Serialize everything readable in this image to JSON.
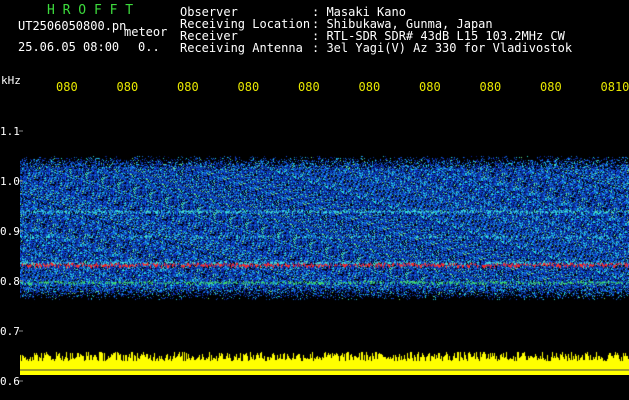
{
  "header": {
    "title": "H R O F F T",
    "filename": "UT2506050800.pn",
    "type_label": "meteor",
    "datetime": "25.06.05 08:00",
    "counter": "0..",
    "fields": [
      {
        "label": "Observer",
        "value": ": Masaki Kano"
      },
      {
        "label": "Receiving Location",
        "value": ": Shibukawa, Gunma, Japan"
      },
      {
        "label": "Receiver",
        "value": ": RTL-SDR SDR# 43dB L15 103.2MHz CW"
      },
      {
        "label": "Receiving Antenna",
        "value": ": 3el Yagi(V) Az 330 for Vladivostok"
      }
    ]
  },
  "axes": {
    "y_unit": "kHz",
    "y_ticks": [
      "1.1",
      "1.0",
      "0.9",
      "0.8",
      "0.7",
      "0.6"
    ],
    "x_ticks": [
      "080",
      "080",
      "080",
      "080",
      "080",
      "080",
      "080",
      "080",
      "080",
      "0810"
    ]
  },
  "colors": {
    "background": "#000000",
    "noise_low": "#0b1a8f",
    "noise_mid": "#1f5fe0",
    "echo_line": "#ff2a2a",
    "secondary_line": "#3de0e0",
    "intensity_bar": "#ffff00",
    "axis_text": "#ffffff",
    "time_text": "#e8e800",
    "title_text": "#3ddc3d"
  }
}
